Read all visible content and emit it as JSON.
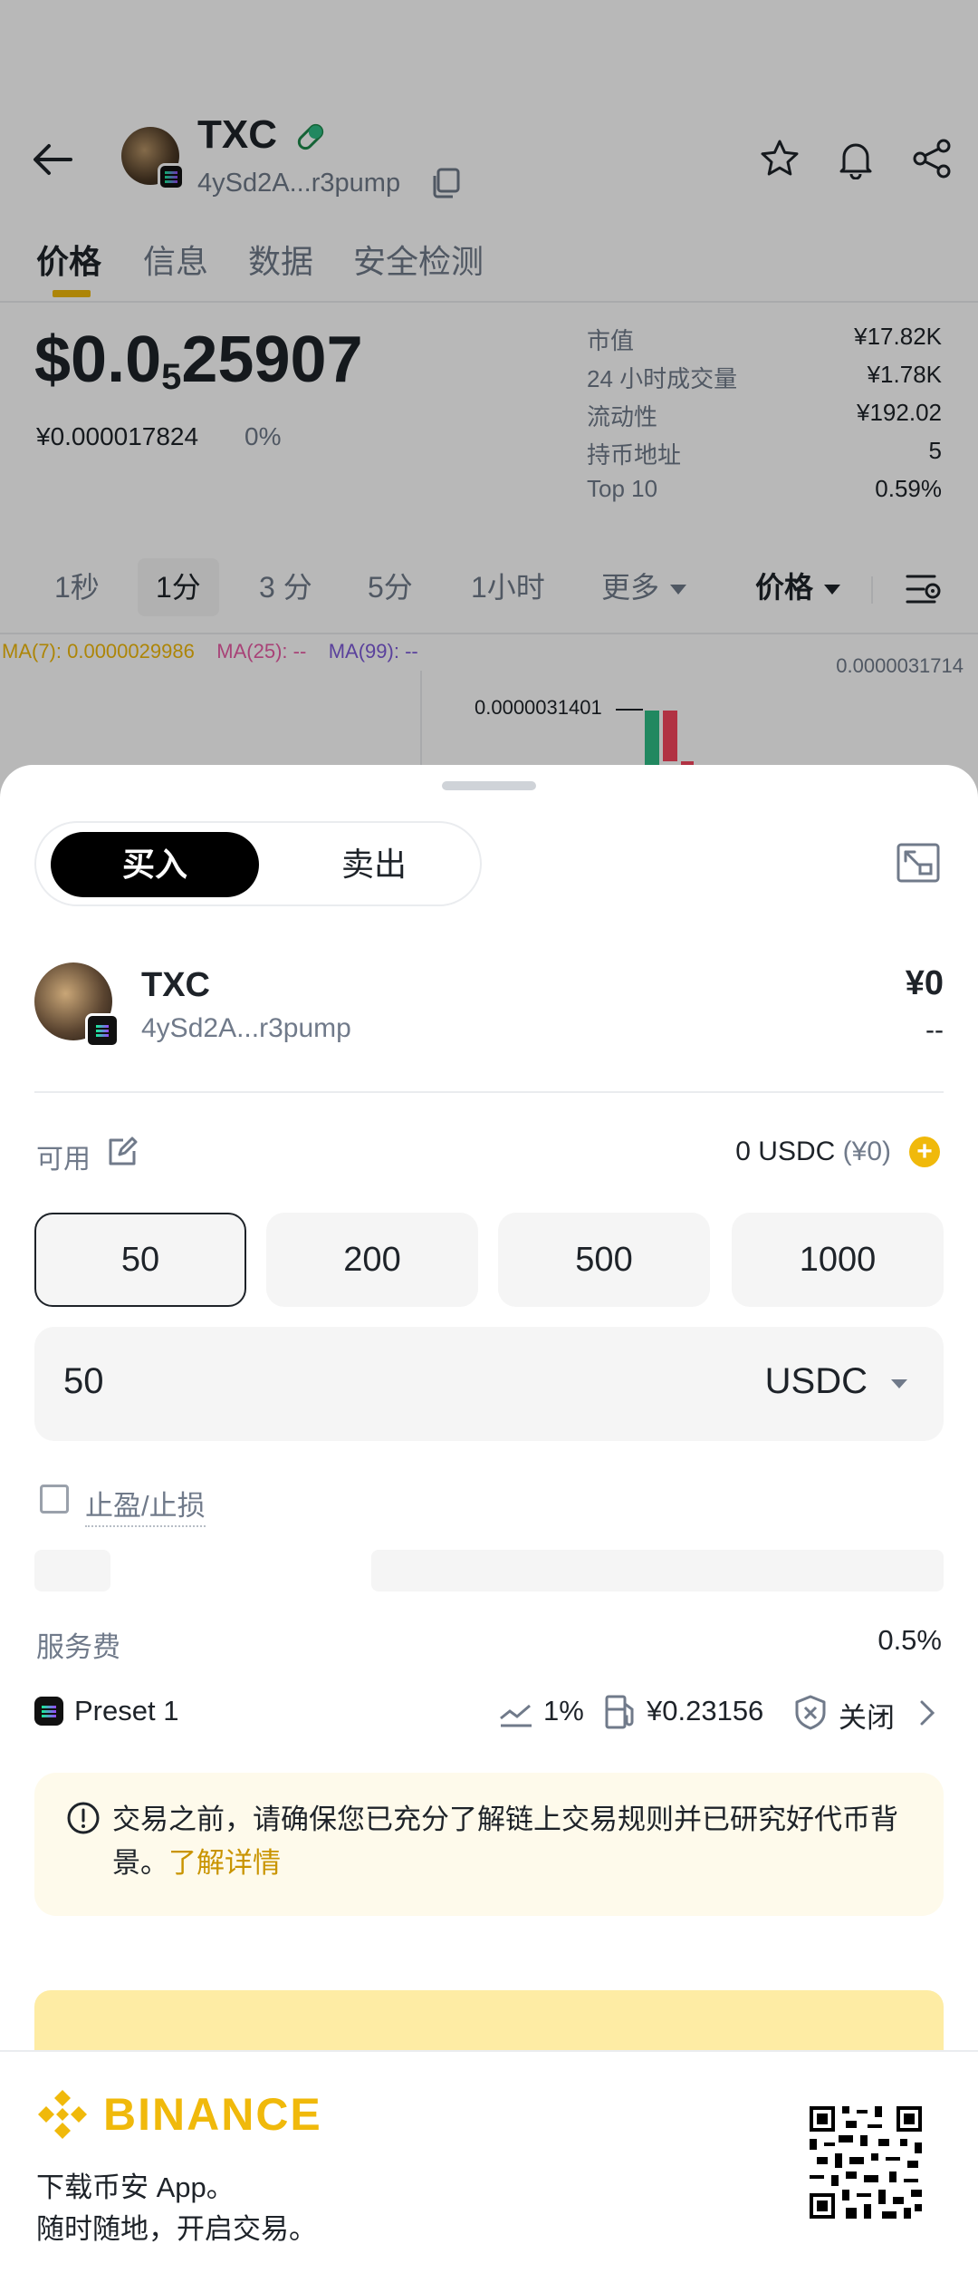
{
  "header": {
    "token_symbol": "TXC",
    "token_address": "4ySd2A...r3pump"
  },
  "tabs": [
    {
      "label": "价格"
    },
    {
      "label": "信息"
    },
    {
      "label": "数据"
    },
    {
      "label": "安全检测"
    }
  ],
  "price": {
    "prefix": "$0.0",
    "zero_count": "5",
    "digits": "25907",
    "cny": "¥0.000017824",
    "change": "0%"
  },
  "stats": [
    {
      "label": "市值",
      "value": "¥17.82K"
    },
    {
      "label": "24 小时成交量",
      "value": "¥1.78K"
    },
    {
      "label": "流动性",
      "value": "¥192.02"
    },
    {
      "label": "持币地址",
      "value": "5"
    },
    {
      "label": "Top 10",
      "value": "0.59%"
    }
  ],
  "intervals": [
    {
      "label": "1秒"
    },
    {
      "label": "1分"
    },
    {
      "label": "3 分"
    },
    {
      "label": "5分"
    },
    {
      "label": "1小时"
    },
    {
      "label": "更多"
    },
    {
      "label": "价格"
    }
  ],
  "chart": {
    "ma7": "MA(7): 0.0000029986",
    "ma25": "MA(25): --",
    "ma99": "MA(99): --",
    "axis_top": "0.0000031714",
    "high_label": "0.0000031401",
    "up_color": "#2ebd85",
    "down_color": "#f6465d"
  },
  "trade": {
    "buy_label": "买入",
    "sell_label": "卖出",
    "token_symbol": "TXC",
    "token_address": "4ySd2A...r3pump",
    "token_value": "¥0",
    "token_value_sub": "--",
    "available_label": "可用",
    "available_amount": "0 USDC",
    "available_cny": "(¥0)",
    "plus": "+",
    "amounts": [
      {
        "label": "50"
      },
      {
        "label": "200"
      },
      {
        "label": "500"
      },
      {
        "label": "1000"
      }
    ],
    "input_value": "50",
    "input_currency": "USDC",
    "tpsl_label": "止盈/止损",
    "fee_label": "服务费",
    "fee_value": "0.5%",
    "preset_name": "Preset 1",
    "slippage": "1%",
    "gas": "¥0.23156",
    "mev": "关闭",
    "notice_text": "交易之前，请确保您已充分了解链上交易规则并已研究好代币背景。",
    "notice_link": "了解详情"
  },
  "footer": {
    "brand": "BINANCE",
    "line1": "下载币安 App。",
    "line2": "随时随地，开启交易。"
  },
  "colors": {
    "accent": "#f0b90b",
    "text_primary": "#1e2329",
    "text_secondary": "#707a8a"
  }
}
